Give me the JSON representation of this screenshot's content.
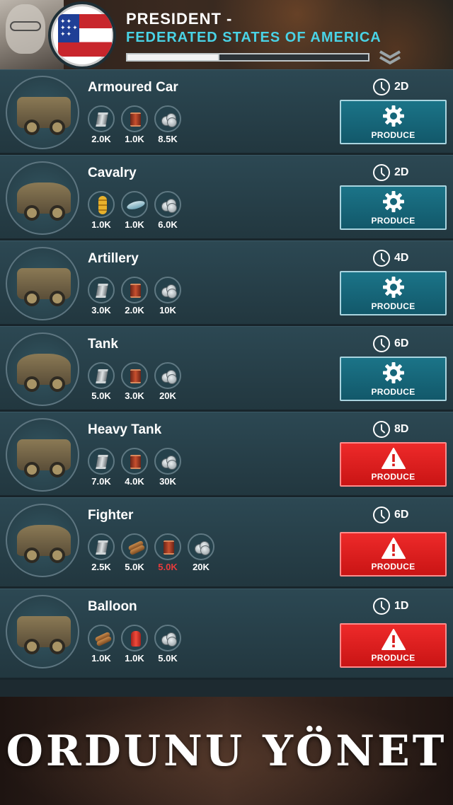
{
  "header": {
    "title": "PRESIDENT -",
    "subtitle": "FEDERATED STATES OF AMERICA",
    "progress_fraction": 0.38,
    "expand_icon": "double-chevron-down-icon"
  },
  "produce_label": "PRODUCE",
  "units": [
    {
      "name": "Armoured Car",
      "time": "2D",
      "status": "available",
      "resources": [
        {
          "icon": "steel-icon",
          "amount": "2.0K"
        },
        {
          "icon": "oil-icon",
          "amount": "1.0K"
        },
        {
          "icon": "coins-icon",
          "amount": "8.5K"
        }
      ]
    },
    {
      "name": "Cavalry",
      "time": "2D",
      "status": "available",
      "resources": [
        {
          "icon": "wheat-icon",
          "amount": "1.0K"
        },
        {
          "icon": "fish-icon",
          "amount": "1.0K"
        },
        {
          "icon": "coins-icon",
          "amount": "6.0K"
        }
      ]
    },
    {
      "name": "Artillery",
      "time": "4D",
      "status": "available",
      "resources": [
        {
          "icon": "steel-icon",
          "amount": "3.0K"
        },
        {
          "icon": "oil-icon",
          "amount": "2.0K"
        },
        {
          "icon": "coins-icon",
          "amount": "10K"
        }
      ]
    },
    {
      "name": "Tank",
      "time": "6D",
      "status": "available",
      "resources": [
        {
          "icon": "steel-icon",
          "amount": "5.0K"
        },
        {
          "icon": "oil-icon",
          "amount": "3.0K"
        },
        {
          "icon": "coins-icon",
          "amount": "20K"
        }
      ]
    },
    {
      "name": "Heavy Tank",
      "time": "8D",
      "status": "warning",
      "resources": [
        {
          "icon": "steel-icon",
          "amount": "7.0K"
        },
        {
          "icon": "oil-icon",
          "amount": "4.0K"
        },
        {
          "icon": "coins-icon",
          "amount": "30K"
        }
      ]
    },
    {
      "name": "Fighter",
      "time": "6D",
      "status": "warning",
      "resources": [
        {
          "icon": "steel-icon",
          "amount": "2.5K"
        },
        {
          "icon": "wood-icon",
          "amount": "5.0K"
        },
        {
          "icon": "oil-icon",
          "amount": "5.0K",
          "insufficient": true
        },
        {
          "icon": "coins-icon",
          "amount": "20K"
        }
      ]
    },
    {
      "name": "Balloon",
      "time": "1D",
      "status": "warning",
      "resources": [
        {
          "icon": "wood-icon",
          "amount": "1.0K"
        },
        {
          "icon": "gas-icon",
          "amount": "1.0K"
        },
        {
          "icon": "coins-icon",
          "amount": "5.0K"
        }
      ]
    }
  ],
  "footer": {
    "slogan": "ORDUNU YÖNET"
  },
  "colors": {
    "produce_available": "#12586a",
    "produce_warning": "#e21f1f",
    "subtitle": "#49d3e6",
    "insufficient": "#e93b3b"
  }
}
